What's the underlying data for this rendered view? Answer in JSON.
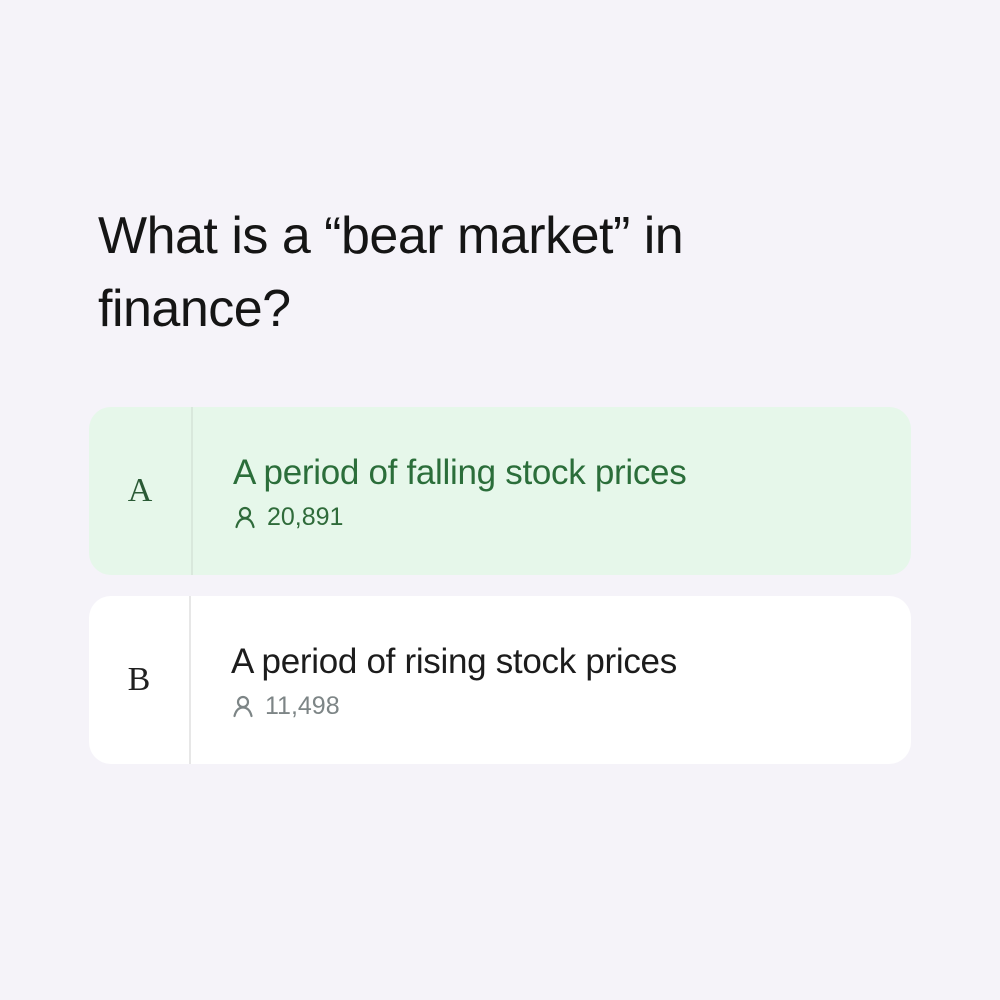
{
  "question": {
    "text": "What is a “bear market” in finance?"
  },
  "options": [
    {
      "letter": "A",
      "text": "A period of falling stock prices",
      "votes": "20,891",
      "icon": "user-icon",
      "selected": true
    },
    {
      "letter": "B",
      "text": "A period of rising stock prices",
      "votes": "11,498",
      "icon": "user-icon",
      "selected": false
    }
  ],
  "colors": {
    "background": "#f5f3f9",
    "selected_bg": "#e6f7ea",
    "selected_text": "#2b6e3a",
    "option_bg": "#ffffff",
    "votes_gray": "#7d8586"
  }
}
